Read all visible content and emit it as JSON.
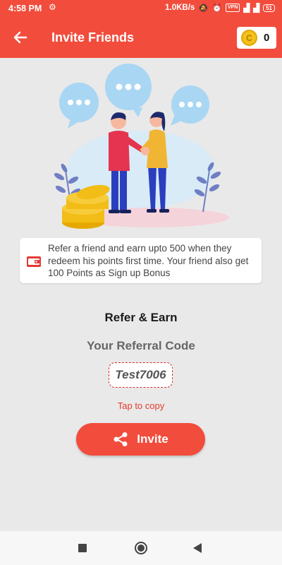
{
  "status": {
    "time": "4:58 PM",
    "network_speed": "1.0KB/s",
    "vpn_badge": "VPN",
    "battery": "51"
  },
  "header": {
    "title": "Invite Friends",
    "coin_count": "0",
    "coin_symbol": "C"
  },
  "info_card": {
    "text": "Refer a friend and earn upto 500 when they redeem his points first time. Your friend also get 100  Points as Sign up Bonus"
  },
  "referral": {
    "section_title": "Refer & Earn",
    "code_label": "Your Referral Code",
    "code": "Test7006",
    "tap_hint": "Tap to copy"
  },
  "actions": {
    "invite_label": "Invite"
  },
  "colors": {
    "primary": "#f24c3c",
    "background": "#e9e9e9"
  }
}
